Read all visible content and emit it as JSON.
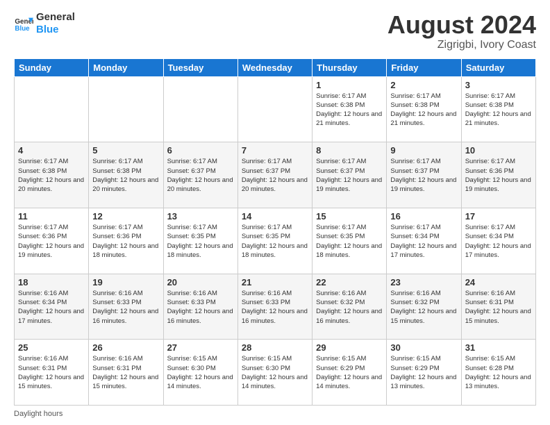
{
  "logo": {
    "text_general": "General",
    "text_blue": "Blue"
  },
  "header": {
    "month": "August 2024",
    "location": "Zigrigbi, Ivory Coast"
  },
  "weekdays": [
    "Sunday",
    "Monday",
    "Tuesday",
    "Wednesday",
    "Thursday",
    "Friday",
    "Saturday"
  ],
  "weeks": [
    [
      {
        "day": "",
        "info": ""
      },
      {
        "day": "",
        "info": ""
      },
      {
        "day": "",
        "info": ""
      },
      {
        "day": "",
        "info": ""
      },
      {
        "day": "1",
        "info": "Sunrise: 6:17 AM\nSunset: 6:38 PM\nDaylight: 12 hours and 21 minutes."
      },
      {
        "day": "2",
        "info": "Sunrise: 6:17 AM\nSunset: 6:38 PM\nDaylight: 12 hours and 21 minutes."
      },
      {
        "day": "3",
        "info": "Sunrise: 6:17 AM\nSunset: 6:38 PM\nDaylight: 12 hours and 21 minutes."
      }
    ],
    [
      {
        "day": "4",
        "info": "Sunrise: 6:17 AM\nSunset: 6:38 PM\nDaylight: 12 hours and 20 minutes."
      },
      {
        "day": "5",
        "info": "Sunrise: 6:17 AM\nSunset: 6:38 PM\nDaylight: 12 hours and 20 minutes."
      },
      {
        "day": "6",
        "info": "Sunrise: 6:17 AM\nSunset: 6:37 PM\nDaylight: 12 hours and 20 minutes."
      },
      {
        "day": "7",
        "info": "Sunrise: 6:17 AM\nSunset: 6:37 PM\nDaylight: 12 hours and 20 minutes."
      },
      {
        "day": "8",
        "info": "Sunrise: 6:17 AM\nSunset: 6:37 PM\nDaylight: 12 hours and 19 minutes."
      },
      {
        "day": "9",
        "info": "Sunrise: 6:17 AM\nSunset: 6:37 PM\nDaylight: 12 hours and 19 minutes."
      },
      {
        "day": "10",
        "info": "Sunrise: 6:17 AM\nSunset: 6:36 PM\nDaylight: 12 hours and 19 minutes."
      }
    ],
    [
      {
        "day": "11",
        "info": "Sunrise: 6:17 AM\nSunset: 6:36 PM\nDaylight: 12 hours and 19 minutes."
      },
      {
        "day": "12",
        "info": "Sunrise: 6:17 AM\nSunset: 6:36 PM\nDaylight: 12 hours and 18 minutes."
      },
      {
        "day": "13",
        "info": "Sunrise: 6:17 AM\nSunset: 6:35 PM\nDaylight: 12 hours and 18 minutes."
      },
      {
        "day": "14",
        "info": "Sunrise: 6:17 AM\nSunset: 6:35 PM\nDaylight: 12 hours and 18 minutes."
      },
      {
        "day": "15",
        "info": "Sunrise: 6:17 AM\nSunset: 6:35 PM\nDaylight: 12 hours and 18 minutes."
      },
      {
        "day": "16",
        "info": "Sunrise: 6:17 AM\nSunset: 6:34 PM\nDaylight: 12 hours and 17 minutes."
      },
      {
        "day": "17",
        "info": "Sunrise: 6:17 AM\nSunset: 6:34 PM\nDaylight: 12 hours and 17 minutes."
      }
    ],
    [
      {
        "day": "18",
        "info": "Sunrise: 6:16 AM\nSunset: 6:34 PM\nDaylight: 12 hours and 17 minutes."
      },
      {
        "day": "19",
        "info": "Sunrise: 6:16 AM\nSunset: 6:33 PM\nDaylight: 12 hours and 16 minutes."
      },
      {
        "day": "20",
        "info": "Sunrise: 6:16 AM\nSunset: 6:33 PM\nDaylight: 12 hours and 16 minutes."
      },
      {
        "day": "21",
        "info": "Sunrise: 6:16 AM\nSunset: 6:33 PM\nDaylight: 12 hours and 16 minutes."
      },
      {
        "day": "22",
        "info": "Sunrise: 6:16 AM\nSunset: 6:32 PM\nDaylight: 12 hours and 16 minutes."
      },
      {
        "day": "23",
        "info": "Sunrise: 6:16 AM\nSunset: 6:32 PM\nDaylight: 12 hours and 15 minutes."
      },
      {
        "day": "24",
        "info": "Sunrise: 6:16 AM\nSunset: 6:31 PM\nDaylight: 12 hours and 15 minutes."
      }
    ],
    [
      {
        "day": "25",
        "info": "Sunrise: 6:16 AM\nSunset: 6:31 PM\nDaylight: 12 hours and 15 minutes."
      },
      {
        "day": "26",
        "info": "Sunrise: 6:16 AM\nSunset: 6:31 PM\nDaylight: 12 hours and 15 minutes."
      },
      {
        "day": "27",
        "info": "Sunrise: 6:15 AM\nSunset: 6:30 PM\nDaylight: 12 hours and 14 minutes."
      },
      {
        "day": "28",
        "info": "Sunrise: 6:15 AM\nSunset: 6:30 PM\nDaylight: 12 hours and 14 minutes."
      },
      {
        "day": "29",
        "info": "Sunrise: 6:15 AM\nSunset: 6:29 PM\nDaylight: 12 hours and 14 minutes."
      },
      {
        "day": "30",
        "info": "Sunrise: 6:15 AM\nSunset: 6:29 PM\nDaylight: 12 hours and 13 minutes."
      },
      {
        "day": "31",
        "info": "Sunrise: 6:15 AM\nSunset: 6:28 PM\nDaylight: 12 hours and 13 minutes."
      }
    ]
  ],
  "footer": {
    "daylight_label": "Daylight hours"
  }
}
